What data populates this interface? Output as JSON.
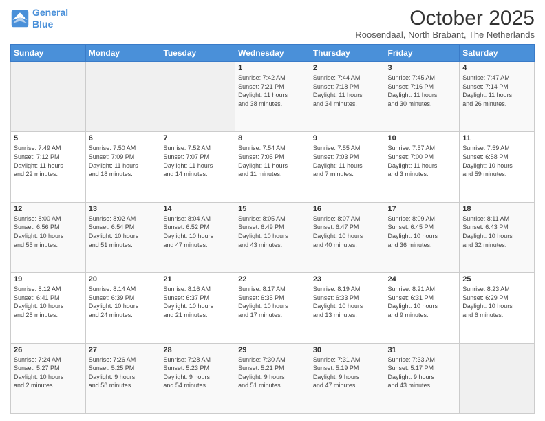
{
  "logo": {
    "line1": "General",
    "line2": "Blue"
  },
  "header": {
    "month": "October 2025",
    "location": "Roosendaal, North Brabant, The Netherlands"
  },
  "weekdays": [
    "Sunday",
    "Monday",
    "Tuesday",
    "Wednesday",
    "Thursday",
    "Friday",
    "Saturday"
  ],
  "weeks": [
    [
      {
        "day": "",
        "info": ""
      },
      {
        "day": "",
        "info": ""
      },
      {
        "day": "",
        "info": ""
      },
      {
        "day": "1",
        "info": "Sunrise: 7:42 AM\nSunset: 7:21 PM\nDaylight: 11 hours\nand 38 minutes."
      },
      {
        "day": "2",
        "info": "Sunrise: 7:44 AM\nSunset: 7:18 PM\nDaylight: 11 hours\nand 34 minutes."
      },
      {
        "day": "3",
        "info": "Sunrise: 7:45 AM\nSunset: 7:16 PM\nDaylight: 11 hours\nand 30 minutes."
      },
      {
        "day": "4",
        "info": "Sunrise: 7:47 AM\nSunset: 7:14 PM\nDaylight: 11 hours\nand 26 minutes."
      }
    ],
    [
      {
        "day": "5",
        "info": "Sunrise: 7:49 AM\nSunset: 7:12 PM\nDaylight: 11 hours\nand 22 minutes."
      },
      {
        "day": "6",
        "info": "Sunrise: 7:50 AM\nSunset: 7:09 PM\nDaylight: 11 hours\nand 18 minutes."
      },
      {
        "day": "7",
        "info": "Sunrise: 7:52 AM\nSunset: 7:07 PM\nDaylight: 11 hours\nand 14 minutes."
      },
      {
        "day": "8",
        "info": "Sunrise: 7:54 AM\nSunset: 7:05 PM\nDaylight: 11 hours\nand 11 minutes."
      },
      {
        "day": "9",
        "info": "Sunrise: 7:55 AM\nSunset: 7:03 PM\nDaylight: 11 hours\nand 7 minutes."
      },
      {
        "day": "10",
        "info": "Sunrise: 7:57 AM\nSunset: 7:00 PM\nDaylight: 11 hours\nand 3 minutes."
      },
      {
        "day": "11",
        "info": "Sunrise: 7:59 AM\nSunset: 6:58 PM\nDaylight: 10 hours\nand 59 minutes."
      }
    ],
    [
      {
        "day": "12",
        "info": "Sunrise: 8:00 AM\nSunset: 6:56 PM\nDaylight: 10 hours\nand 55 minutes."
      },
      {
        "day": "13",
        "info": "Sunrise: 8:02 AM\nSunset: 6:54 PM\nDaylight: 10 hours\nand 51 minutes."
      },
      {
        "day": "14",
        "info": "Sunrise: 8:04 AM\nSunset: 6:52 PM\nDaylight: 10 hours\nand 47 minutes."
      },
      {
        "day": "15",
        "info": "Sunrise: 8:05 AM\nSunset: 6:49 PM\nDaylight: 10 hours\nand 43 minutes."
      },
      {
        "day": "16",
        "info": "Sunrise: 8:07 AM\nSunset: 6:47 PM\nDaylight: 10 hours\nand 40 minutes."
      },
      {
        "day": "17",
        "info": "Sunrise: 8:09 AM\nSunset: 6:45 PM\nDaylight: 10 hours\nand 36 minutes."
      },
      {
        "day": "18",
        "info": "Sunrise: 8:11 AM\nSunset: 6:43 PM\nDaylight: 10 hours\nand 32 minutes."
      }
    ],
    [
      {
        "day": "19",
        "info": "Sunrise: 8:12 AM\nSunset: 6:41 PM\nDaylight: 10 hours\nand 28 minutes."
      },
      {
        "day": "20",
        "info": "Sunrise: 8:14 AM\nSunset: 6:39 PM\nDaylight: 10 hours\nand 24 minutes."
      },
      {
        "day": "21",
        "info": "Sunrise: 8:16 AM\nSunset: 6:37 PM\nDaylight: 10 hours\nand 21 minutes."
      },
      {
        "day": "22",
        "info": "Sunrise: 8:17 AM\nSunset: 6:35 PM\nDaylight: 10 hours\nand 17 minutes."
      },
      {
        "day": "23",
        "info": "Sunrise: 8:19 AM\nSunset: 6:33 PM\nDaylight: 10 hours\nand 13 minutes."
      },
      {
        "day": "24",
        "info": "Sunrise: 8:21 AM\nSunset: 6:31 PM\nDaylight: 10 hours\nand 9 minutes."
      },
      {
        "day": "25",
        "info": "Sunrise: 8:23 AM\nSunset: 6:29 PM\nDaylight: 10 hours\nand 6 minutes."
      }
    ],
    [
      {
        "day": "26",
        "info": "Sunrise: 7:24 AM\nSunset: 5:27 PM\nDaylight: 10 hours\nand 2 minutes."
      },
      {
        "day": "27",
        "info": "Sunrise: 7:26 AM\nSunset: 5:25 PM\nDaylight: 9 hours\nand 58 minutes."
      },
      {
        "day": "28",
        "info": "Sunrise: 7:28 AM\nSunset: 5:23 PM\nDaylight: 9 hours\nand 54 minutes."
      },
      {
        "day": "29",
        "info": "Sunrise: 7:30 AM\nSunset: 5:21 PM\nDaylight: 9 hours\nand 51 minutes."
      },
      {
        "day": "30",
        "info": "Sunrise: 7:31 AM\nSunset: 5:19 PM\nDaylight: 9 hours\nand 47 minutes."
      },
      {
        "day": "31",
        "info": "Sunrise: 7:33 AM\nSunset: 5:17 PM\nDaylight: 9 hours\nand 43 minutes."
      },
      {
        "day": "",
        "info": ""
      }
    ]
  ]
}
